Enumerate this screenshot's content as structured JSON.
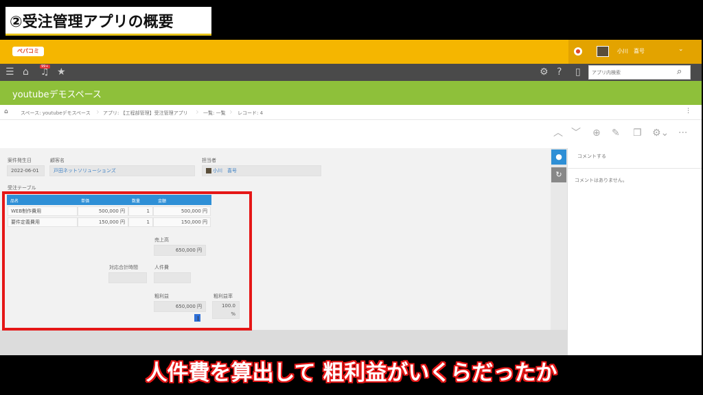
{
  "video": {
    "title": "②受注管理アプリの概要",
    "subtitle": "人件費を算出して 粗利益がいくらだったか"
  },
  "app": {
    "logo": "ぺパコミ",
    "user": {
      "name": "小川　喜号"
    },
    "nav": {
      "badge": "99+"
    },
    "search": {
      "placeholder": "アプリ内検索"
    },
    "space_title": "youtubeデモスペース",
    "breadcrumb": [
      "スペース: youtubeデモスペース",
      "アプリ: 【工程部管理】受注管理アプリ",
      "一覧: 一覧",
      "レコード: 4"
    ]
  },
  "record": {
    "fields": {
      "date_label": "案件発生日",
      "date_value": "2022-06-01",
      "customer_label": "顧客名",
      "customer_value": "戸田ネットソリューションズ",
      "owner_label": "担当者",
      "owner_value": "小川　喜号",
      "table_label": "受注テーブル"
    },
    "table": {
      "headers": [
        "品名",
        "単価",
        "数量",
        "金額"
      ],
      "rows": [
        [
          "WEB制作費用",
          "500,000 円",
          "1",
          "500,000 円"
        ],
        [
          "要件定義費用",
          "150,000 円",
          "1",
          "150,000 円"
        ]
      ]
    },
    "summary": {
      "sales_label": "売上高",
      "sales_value": "650,000 円",
      "hours_label": "対応合計時間",
      "hours_value": "",
      "labor_label": "人件費",
      "labor_value": "",
      "profit_label": "粗利益",
      "profit_value": "650,000 円",
      "rate_label": "粗利益率",
      "rate_value": "100.0",
      "rate_unit": "%"
    }
  },
  "comments": {
    "post_label": "コメントする",
    "empty": "コメントはありません。"
  },
  "colors": {
    "topbar": "#f5b600",
    "banner": "#8ec03a",
    "table_header": "#2e8fd6",
    "highlight": "#e51717"
  }
}
